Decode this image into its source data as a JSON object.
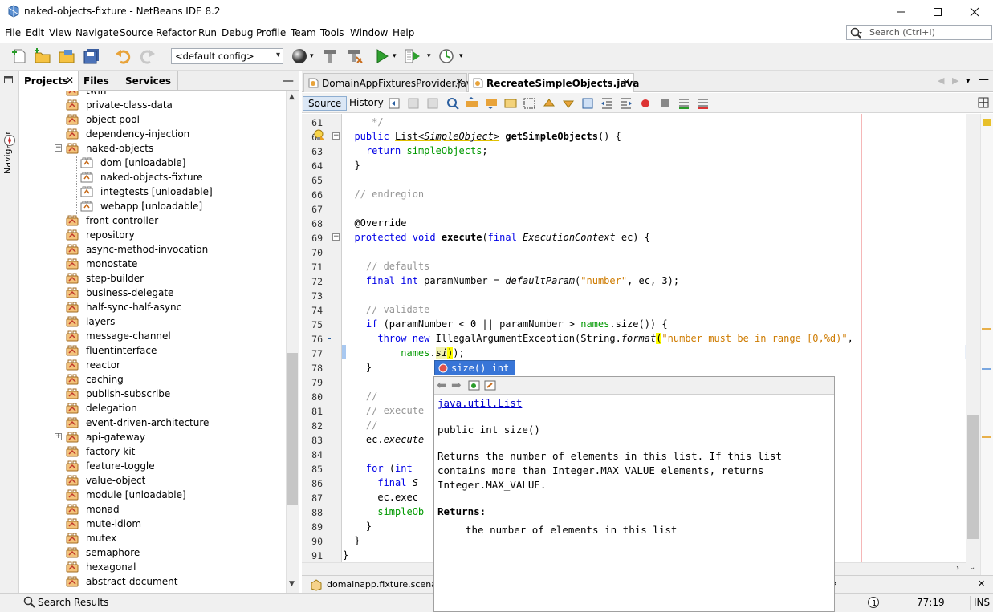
{
  "window": {
    "title": "naked-objects-fixture - NetBeans IDE 8.2",
    "minimize_icon": "minimize-icon",
    "maximize_icon": "maximize-icon",
    "close_icon": "close-icon"
  },
  "menu": {
    "items": [
      "File",
      "Edit",
      "View",
      "Navigate",
      "Source",
      "Refactor",
      "Run",
      "Debug",
      "Profile",
      "Team",
      "Tools",
      "Window",
      "Help"
    ],
    "search_placeholder": "Search (Ctrl+I)"
  },
  "toolbar": {
    "config": "<default config>",
    "icons": [
      "new-file-icon",
      "new-project-icon",
      "open-project-icon",
      "save-all-icon",
      "undo-icon",
      "redo-icon",
      "globe-icon",
      "hammer-icon",
      "clean-build-icon",
      "run-icon",
      "debug-icon",
      "profile-icon"
    ]
  },
  "sidebar": {
    "navigator_label": "Navigator",
    "tabs": [
      "Projects",
      "Files",
      "Services"
    ],
    "tree": [
      {
        "label": "twin",
        "level": 0
      },
      {
        "label": "private-class-data",
        "level": 0
      },
      {
        "label": "object-pool",
        "level": 0
      },
      {
        "label": "dependency-injection",
        "level": 0
      },
      {
        "label": "naked-objects",
        "level": 0,
        "expanded": true
      },
      {
        "label": "dom [unloadable]",
        "level": 1
      },
      {
        "label": "naked-objects-fixture",
        "level": 1
      },
      {
        "label": "integtests [unloadable]",
        "level": 1
      },
      {
        "label": "webapp [unloadable]",
        "level": 1
      },
      {
        "label": "front-controller",
        "level": 0
      },
      {
        "label": "repository",
        "level": 0
      },
      {
        "label": "async-method-invocation",
        "level": 0
      },
      {
        "label": "monostate",
        "level": 0
      },
      {
        "label": "step-builder",
        "level": 0
      },
      {
        "label": "business-delegate",
        "level": 0
      },
      {
        "label": "half-sync-half-async",
        "level": 0
      },
      {
        "label": "layers",
        "level": 0
      },
      {
        "label": "message-channel",
        "level": 0
      },
      {
        "label": "fluentinterface",
        "level": 0
      },
      {
        "label": "reactor",
        "level": 0
      },
      {
        "label": "caching",
        "level": 0
      },
      {
        "label": "publish-subscribe",
        "level": 0
      },
      {
        "label": "delegation",
        "level": 0
      },
      {
        "label": "event-driven-architecture",
        "level": 0
      },
      {
        "label": "api-gateway",
        "level": 0,
        "collapsed": true
      },
      {
        "label": "factory-kit",
        "level": 0
      },
      {
        "label": "feature-toggle",
        "level": 0
      },
      {
        "label": "value-object",
        "level": 0
      },
      {
        "label": "module [unloadable]",
        "level": 0
      },
      {
        "label": "monad",
        "level": 0
      },
      {
        "label": "mute-idiom",
        "level": 0
      },
      {
        "label": "mutex",
        "level": 0
      },
      {
        "label": "semaphore",
        "level": 0
      },
      {
        "label": "hexagonal",
        "level": 0
      },
      {
        "label": "abstract-document",
        "level": 0
      }
    ]
  },
  "editor": {
    "tabs": [
      "DomainAppFixturesProvider.java",
      "RecreateSimpleObjects.java"
    ],
    "active_tab": 1,
    "source_label": "Source",
    "history_label": "History",
    "line_numbers": [
      "61",
      "62",
      "63",
      "64",
      "65",
      "66",
      "67",
      "68",
      "69",
      "70",
      "71",
      "72",
      "73",
      "74",
      "75",
      "76",
      "77",
      "78",
      "79",
      "80",
      "81",
      "82",
      "83",
      "84",
      "85",
      "86",
      "87",
      "88",
      "89",
      "90",
      "91"
    ],
    "navigator_path": "domainapp.fixture.scenarios"
  },
  "completion": {
    "item": "size() int",
    "doc_class": "java.util.List",
    "doc_signature": "public int size()",
    "doc_line1": "Returns the number of elements in this list. If this list",
    "doc_line2": "contains more than Integer.MAX_VALUE elements, returns",
    "doc_line3": "Integer.MAX_VALUE.",
    "doc_returns_label": "Returns:",
    "doc_returns_text": "the number of elements in this list"
  },
  "status": {
    "search_results": "Search Results",
    "position": "77:19",
    "mode": "INS"
  }
}
